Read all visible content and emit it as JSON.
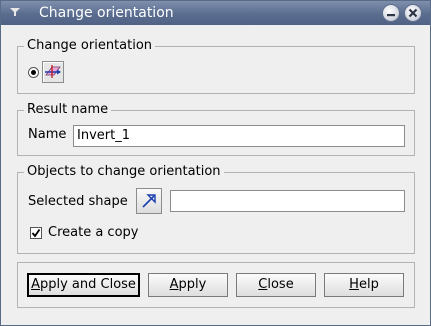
{
  "window": {
    "title": "Change orientation"
  },
  "titlebar_buttons": {
    "minimize_icon": "minimize-icon",
    "close_icon": "close-icon"
  },
  "groups": {
    "orientation": {
      "title": "Change orientation",
      "option_icon": "change-orientation-icon",
      "selected": true
    },
    "result": {
      "title": "Result name",
      "name_label": "Name",
      "name_value": "Invert_1"
    },
    "objects": {
      "title": "Objects to change orientation",
      "selected_shape_label": "Selected shape",
      "select_icon": "arrow-select-icon",
      "selected_shape_value": "",
      "create_copy_label": "Create a copy",
      "create_copy_checked": true
    }
  },
  "buttons": {
    "apply_close": {
      "label": "Apply and Close",
      "mnemonic": "A",
      "rest": "pply and Close"
    },
    "apply": {
      "label": "Apply",
      "mnemonic": "A",
      "rest": "pply"
    },
    "close": {
      "label": "Close",
      "mnemonic": "C",
      "rest": "lose"
    },
    "help": {
      "label": "Help",
      "mnemonic": "H",
      "rest": "elp"
    }
  }
}
